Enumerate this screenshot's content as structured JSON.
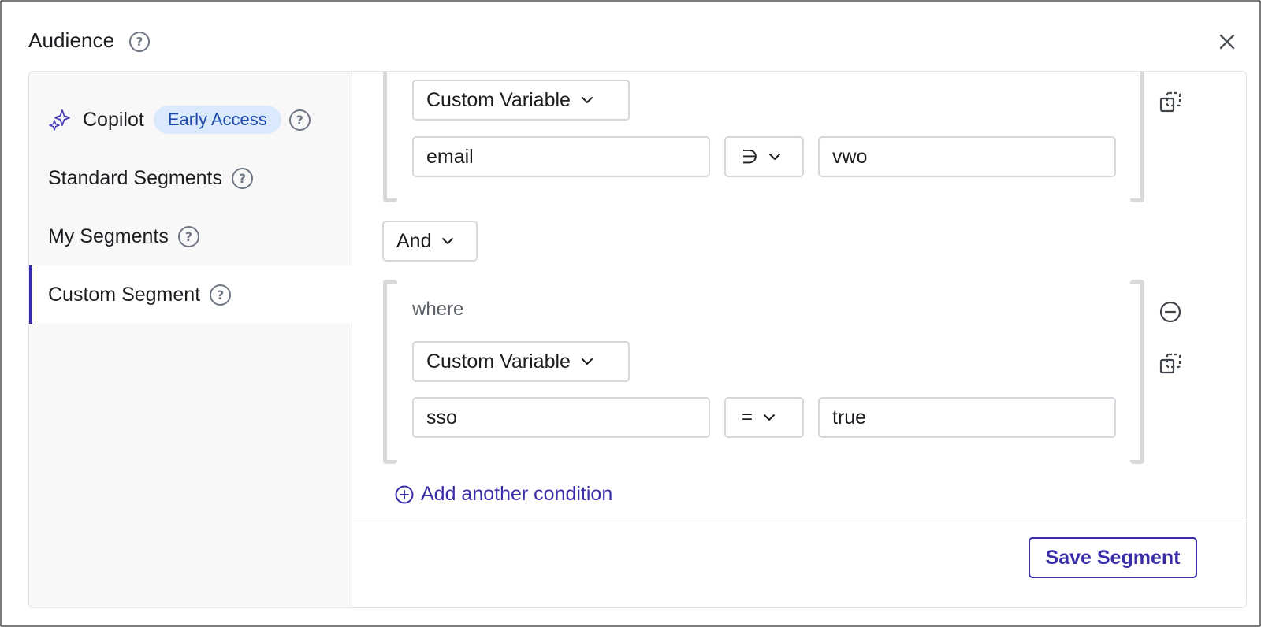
{
  "modal": {
    "title": "Audience",
    "close_icon": "close-icon",
    "help_icon": "help-circle-icon"
  },
  "sidebar": {
    "items": [
      {
        "label": "Copilot",
        "badge": "Early Access",
        "icon": "sparkle-icon",
        "active": false
      },
      {
        "label": "Standard Segments",
        "active": false
      },
      {
        "label": "My Segments",
        "active": false
      },
      {
        "label": "Custom Segment",
        "active": true
      }
    ]
  },
  "conditions": {
    "group1": {
      "type_label": "Custom Variable",
      "variable_value": "email",
      "operator": "∋",
      "compare_value": "vwo"
    },
    "logic_operator": "And",
    "group2": {
      "where_label": "where",
      "type_label": "Custom Variable",
      "variable_value": "sso",
      "operator": "=",
      "compare_value": "true"
    },
    "add_condition_label": "Add another condition"
  },
  "footer": {
    "save_label": "Save Segment"
  },
  "colors": {
    "accent": "#3a2ea8",
    "badge_bg": "#dbe9fd",
    "badge_text": "#1d49a8"
  }
}
